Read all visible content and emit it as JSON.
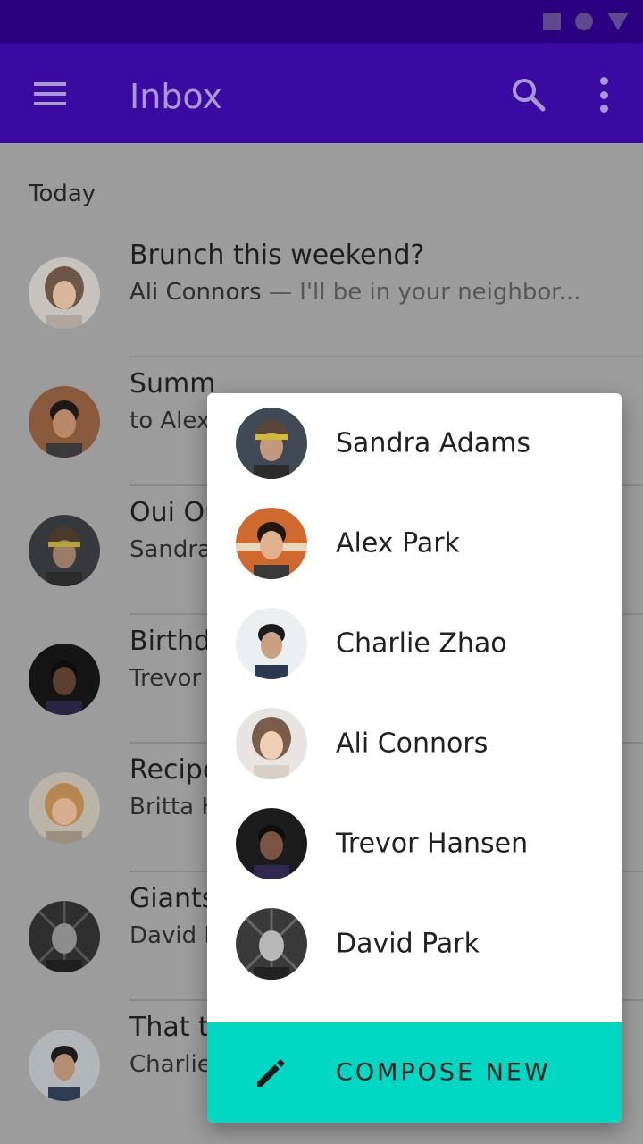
{
  "app": {
    "title": "Inbox"
  },
  "status_bar": {
    "icons": [
      "square-icon",
      "circle-icon",
      "triangle-icon"
    ]
  },
  "icons": {
    "menu": "menu-icon",
    "search": "search-icon",
    "more": "more-vert-icon",
    "compose": "pencil-icon"
  },
  "inbox": {
    "section": "Today",
    "items": [
      {
        "title": "Brunch this weekend?",
        "from": "Ali Connors",
        "snippet": "— I'll be in your neighbor..."
      },
      {
        "title": "Summ",
        "from": "to Alex",
        "snippet": ""
      },
      {
        "title": "Oui Ou",
        "from": "Sandra",
        "snippet": ""
      },
      {
        "title": "Birthd",
        "from": "Trevor",
        "snippet": ""
      },
      {
        "title": "Recipe",
        "from": "Britta H",
        "snippet": ""
      },
      {
        "title": "Giants",
        "from": "David P",
        "snippet": ""
      },
      {
        "title": "That t",
        "from": "Charlie",
        "snippet": ""
      }
    ]
  },
  "compose_menu": {
    "contacts": [
      {
        "name": "Sandra Adams"
      },
      {
        "name": "Alex Park"
      },
      {
        "name": "Charlie Zhao"
      },
      {
        "name": "Ali Connors"
      },
      {
        "name": "Trevor Hansen"
      },
      {
        "name": "David Park"
      }
    ],
    "compose_label": "COMPOSE NEW"
  },
  "colors": {
    "status_bar": "#2a0080",
    "app_bar": "#3a0aa3",
    "scrim_background": "#9c9c9c",
    "compose_accent": "#00d8c4"
  }
}
